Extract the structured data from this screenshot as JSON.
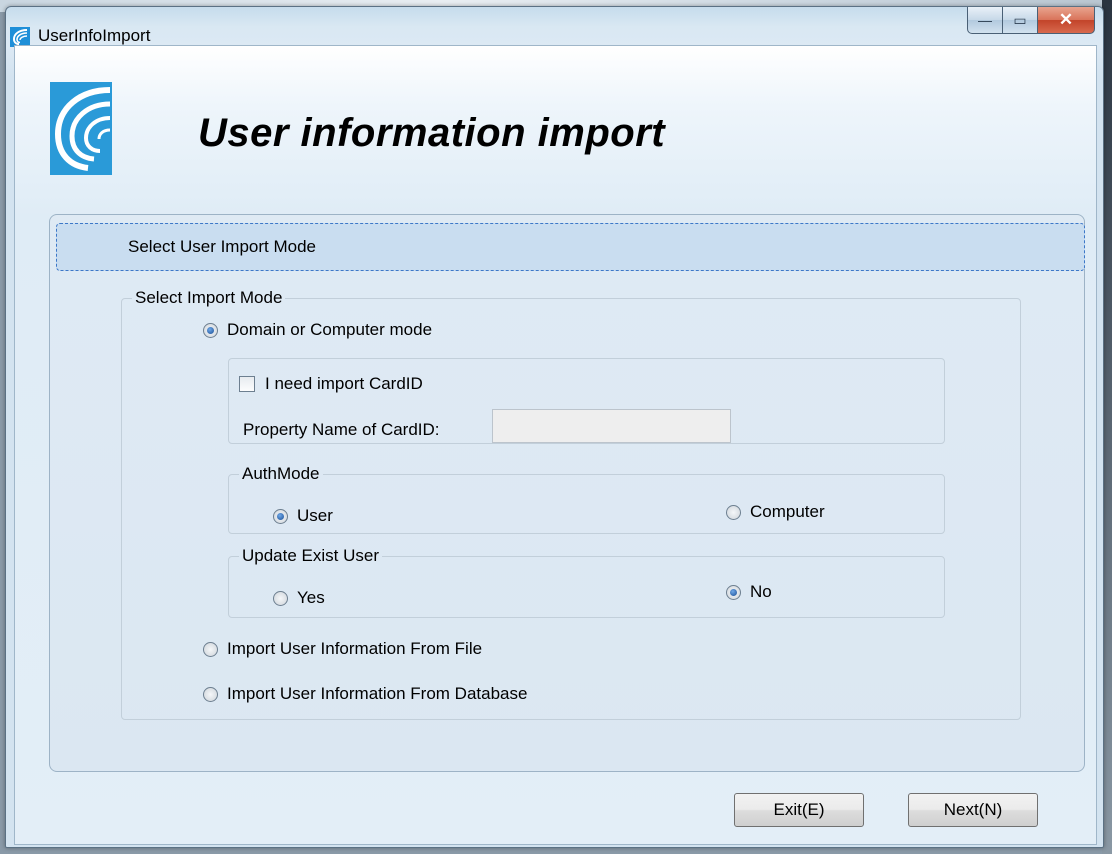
{
  "window": {
    "title": "UserInfoImport",
    "minimize_glyph": "—",
    "maximize_glyph": "▭",
    "close_glyph": "✕"
  },
  "header": {
    "title": "User information import"
  },
  "step": {
    "label": "Select User Import Mode"
  },
  "import_mode": {
    "legend": "Select Import Mode",
    "options": [
      {
        "label": "Domain or Computer mode",
        "selected": true
      },
      {
        "label": "Import User Information From File",
        "selected": false
      },
      {
        "label": "Import User Information From Database",
        "selected": false
      }
    ],
    "card_id": {
      "checkbox_label": "I need import CardID",
      "checked": false,
      "property_label": "Property Name of CardID:",
      "property_value": ""
    },
    "auth_mode": {
      "legend": "AuthMode",
      "options": [
        {
          "label": "User",
          "selected": true
        },
        {
          "label": "Computer",
          "selected": false
        }
      ]
    },
    "update_exist_user": {
      "legend": "Update Exist User",
      "options": [
        {
          "label": "Yes",
          "selected": false
        },
        {
          "label": "No",
          "selected": true
        }
      ]
    }
  },
  "buttons": {
    "exit": "Exit(E)",
    "next": "Next(N)"
  },
  "colors": {
    "accent": "#1b4f95",
    "step_bar": "#c9ddf0",
    "close_button": "#c2442a"
  }
}
